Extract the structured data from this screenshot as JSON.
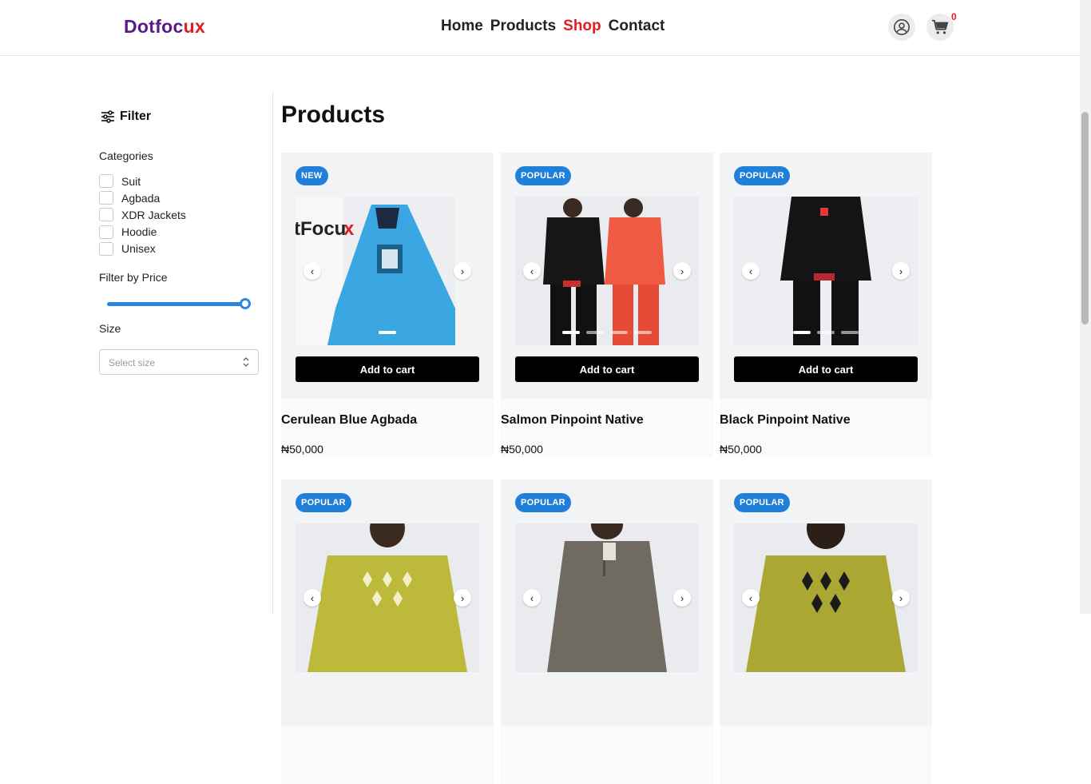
{
  "brand": {
    "part1": "Dotfoc",
    "part2": "ux"
  },
  "nav": [
    {
      "label": "Home",
      "active": false
    },
    {
      "label": "Products",
      "active": false
    },
    {
      "label": "Shop",
      "active": true
    },
    {
      "label": "Contact",
      "active": false
    }
  ],
  "header": {
    "cart_count": "0",
    "icons": [
      "user-icon",
      "cart-icon"
    ]
  },
  "sidebar": {
    "filter_label": "Filter",
    "categories_title": "Categories",
    "categories": [
      "Suit",
      "Agbada",
      "XDR Jackets",
      "Hoodie",
      "Unisex"
    ],
    "price_title": "Filter by Price",
    "price_level": 1.0,
    "size_title": "Size",
    "size_placeholder": "Select size"
  },
  "main": {
    "title": "Products",
    "add_to_cart_label": "Add to cart",
    "products": [
      {
        "badge": "NEW",
        "name": "Cerulean Blue Agbada",
        "price": "₦50,000",
        "slides": 1,
        "active_slide": 0,
        "color": "#3aa6e2"
      },
      {
        "badge": "POPULAR",
        "name": "Salmon Pinpoint Native",
        "price": "₦50,000",
        "slides": 4,
        "active_slide": 0,
        "color": "#1b1b1b"
      },
      {
        "badge": "POPULAR",
        "name": "Black Pinpoint Native",
        "price": "₦50,000",
        "slides": 3,
        "active_slide": 0,
        "color": "#1b1b1b"
      },
      {
        "badge": "POPULAR",
        "name": "",
        "price": "",
        "slides": 0,
        "active_slide": 0,
        "color": "#b9b733"
      },
      {
        "badge": "POPULAR",
        "name": "",
        "price": "",
        "slides": 0,
        "active_slide": 0,
        "color": "#6e6a60"
      },
      {
        "badge": "POPULAR",
        "name": "",
        "price": "",
        "slides": 0,
        "active_slide": 0,
        "color": "#a7a530"
      }
    ]
  },
  "colors": {
    "accent": "#2b86e0",
    "brand_purple": "#5b1a8c",
    "brand_red": "#e01e1e"
  }
}
